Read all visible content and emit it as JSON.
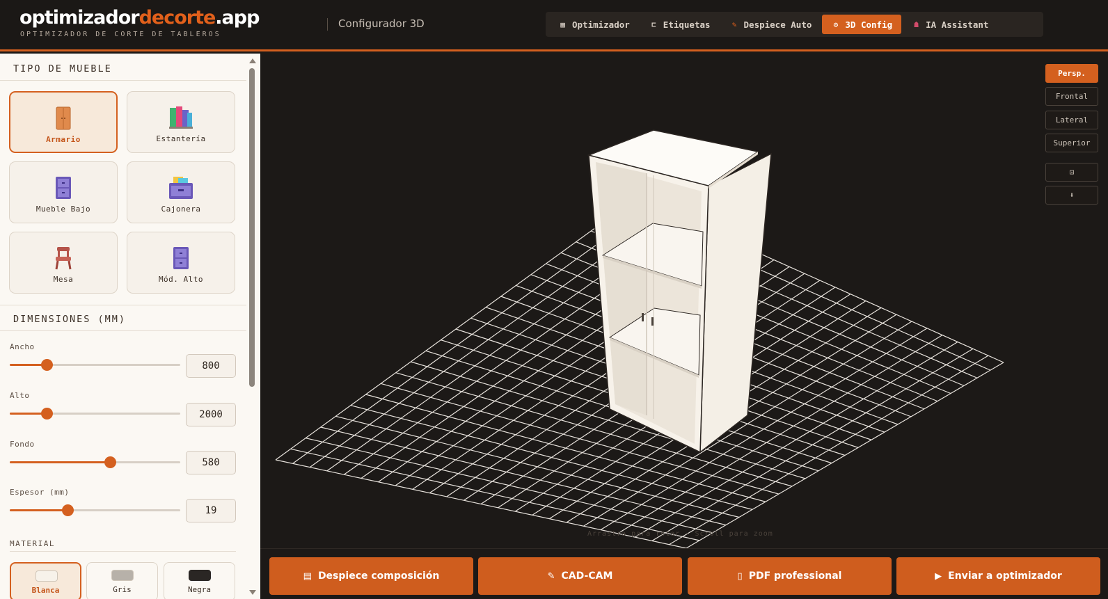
{
  "header": {
    "brand_part1": "optimizador",
    "brand_part2": "decorte",
    "brand_part3": ".app",
    "tagline": "OPTIMIZADOR DE CORTE DE TABLEROS",
    "subtitle": "Configurador 3D",
    "tabs": [
      {
        "label": "Optimizador",
        "icon": "grid-icon"
      },
      {
        "label": "Etiquetas",
        "icon": "tag-icon"
      },
      {
        "label": "Despiece Auto",
        "icon": "pencil-icon"
      },
      {
        "label": "3D Config",
        "icon": "gear-icon",
        "active": true
      },
      {
        "label": "IA Assistant",
        "icon": "robot-icon"
      }
    ]
  },
  "sidebar": {
    "tipo_title": "TIPO DE MUEBLE",
    "types": [
      {
        "label": "Armario",
        "icon": "wardrobe-icon",
        "active": true
      },
      {
        "label": "Estantería",
        "icon": "books-icon"
      },
      {
        "label": "Mueble Bajo",
        "icon": "cabinet-icon"
      },
      {
        "label": "Cajonera",
        "icon": "drawer-icon"
      },
      {
        "label": "Mesa",
        "icon": "chair-icon"
      },
      {
        "label": "Mód. Alto",
        "icon": "tall-module-icon"
      }
    ],
    "dim_title": "DIMENSIONES (MM)",
    "dims": [
      {
        "label": "Ancho",
        "value": "800",
        "level": 0.22
      },
      {
        "label": "Alto",
        "value": "2000",
        "level": 0.22
      },
      {
        "label": "Fondo",
        "value": "580",
        "level": 0.59
      },
      {
        "label": "Espesor (mm)",
        "value": "19",
        "level": 0.34
      }
    ],
    "material_title": "MATERIAL",
    "materials": [
      {
        "label": "Blanca",
        "color": "#f7f2ea",
        "active": true
      },
      {
        "label": "Gris",
        "color": "#b7b1a9"
      },
      {
        "label": "Negra",
        "color": "#2a2624"
      }
    ]
  },
  "viewport": {
    "view_buttons": [
      {
        "label": "Persp.",
        "active": true
      },
      {
        "label": "Frontal"
      },
      {
        "label": "Lateral"
      },
      {
        "label": "Superior"
      }
    ],
    "icon_buttons": [
      {
        "label": "⊡",
        "icon": "fit-view-icon"
      },
      {
        "label": "⬇",
        "icon": "download-icon"
      }
    ],
    "hint": "Arrastra para rotar · Scroll para zoom"
  },
  "actions": [
    {
      "label": "Despiece composición",
      "icon": "clipboard-icon"
    },
    {
      "label": "CAD-CAM",
      "icon": "wrench-icon"
    },
    {
      "label": "PDF professional",
      "icon": "document-icon"
    },
    {
      "label": "Enviar a optimizador",
      "icon": "play-icon"
    }
  ],
  "colors": {
    "accent": "#d4601f",
    "background_dark": "#1c1917",
    "panel": "#fbf8f3"
  }
}
